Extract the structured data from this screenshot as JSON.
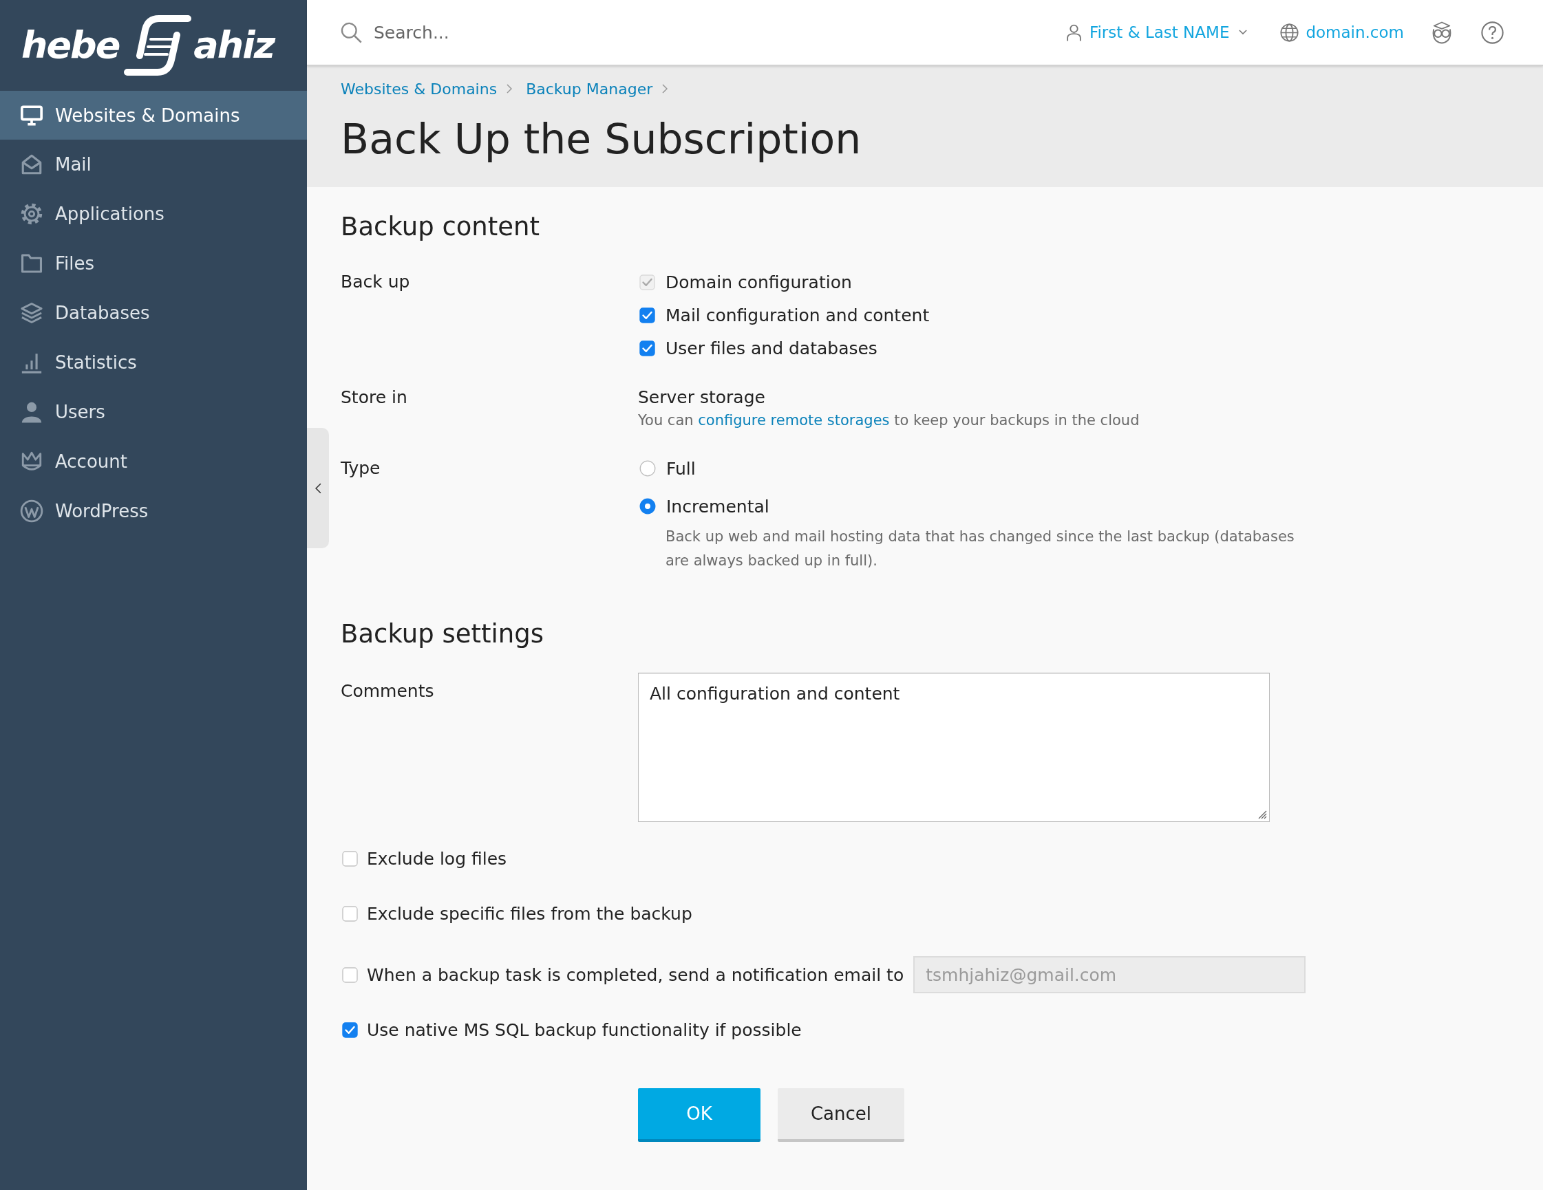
{
  "logo": {
    "text_before": "hebe",
    "text_after": "ahiz"
  },
  "top_bar": {
    "search": {
      "placeholder": "Search..."
    },
    "user": {
      "name": "First & Last NAME"
    },
    "domain": "domain.com"
  },
  "sidebar": {
    "items": [
      {
        "label": "Websites & Domains",
        "selected": true
      },
      {
        "label": "Mail",
        "selected": false
      },
      {
        "label": "Applications",
        "selected": false
      },
      {
        "label": "Files",
        "selected": false
      },
      {
        "label": "Databases",
        "selected": false
      },
      {
        "label": "Statistics",
        "selected": false
      },
      {
        "label": "Users",
        "selected": false
      },
      {
        "label": "Account",
        "selected": false
      },
      {
        "label": "WordPress",
        "selected": false
      }
    ]
  },
  "breadcrumbs": [
    "Websites & Domains",
    "Backup Manager"
  ],
  "page_title": "Back Up the Subscription",
  "sections": [
    {
      "heading": "Backup content",
      "rows": [
        {
          "kind": "checkboxes",
          "label": "Back up",
          "options": [
            {
              "label": "Domain configuration",
              "checked": true,
              "disabled": true
            },
            {
              "label": "Mail configuration and content",
              "checked": true,
              "disabled": false
            },
            {
              "label": "User files and databases",
              "checked": true,
              "disabled": false
            }
          ]
        },
        {
          "kind": "storage",
          "label": "Store in",
          "value": "Server storage",
          "hint": {
            "before": "You can",
            "link": "configure remote storages",
            "after": "to keep your backups in the cloud"
          }
        },
        {
          "kind": "radios",
          "label": "Type",
          "options": [
            {
              "label": "Full",
              "selected": false
            },
            {
              "label": "Incremental",
              "selected": true,
              "description": "Back up web and mail hosting data that has changed since the last backup (databases are always backed up in full)."
            }
          ]
        }
      ]
    },
    {
      "heading": "Backup settings",
      "rows": [
        {
          "kind": "textarea",
          "label": "Comments",
          "value": "All configuration and content"
        },
        {
          "kind": "checkbox",
          "label": "Exclude log files",
          "checked": false
        },
        {
          "kind": "checkbox",
          "label": "Exclude specific files from the backup",
          "checked": false
        },
        {
          "kind": "checkbox_email",
          "label": "When a backup task is completed, send a notification email to",
          "checked": false,
          "email": {
            "value": "tsmhjahiz@gmail.com",
            "disabled": true
          }
        },
        {
          "kind": "checkbox",
          "label": "Use native MS SQL backup functionality if possible",
          "checked": true
        }
      ]
    }
  ],
  "buttons": [
    {
      "label": "OK",
      "kind": "primary"
    },
    {
      "label": "Cancel",
      "kind": "secondary"
    }
  ]
}
